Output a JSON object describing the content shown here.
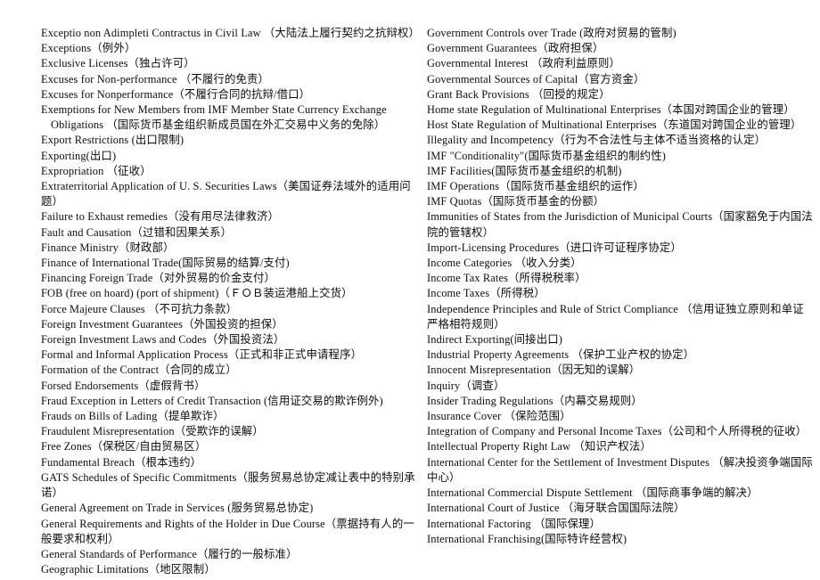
{
  "document": {
    "type": "glossary",
    "title": "",
    "language_pair": "English-Chinese",
    "layout": "two-column"
  },
  "columns": {
    "left": {
      "entries": [
        {
          "text": "Exceptio non Adimpleti Contractus in Civil Law （大陆法上履行契约之抗辩权）",
          "wrap_indent": true
        },
        {
          "text": "Exceptions（例外）",
          "wrap_indent": false
        },
        {
          "text": "Exclusive Licenses（独占许可）",
          "wrap_indent": false
        },
        {
          "text": "Excuses for Non-performance （不履行的免责）",
          "wrap_indent": false
        },
        {
          "text": "Excuses for Nonperformance（不履行合同的抗辩/借口）",
          "wrap_indent": false
        },
        {
          "text": "Exemptions for New Members from IMF Member State Currency Exchange Obligations （国际货币基金组织新成员国在外汇交易中义务的免除）",
          "wrap_indent": true
        },
        {
          "text": "Export Restrictions (出口限制)",
          "wrap_indent": false
        },
        {
          "text": "Exporting(出口)",
          "wrap_indent": false
        },
        {
          "text": "Expropriation （征收）",
          "wrap_indent": false
        },
        {
          "text": "Extraterritorial Application of U. S. Securities Laws（美国证券法域外的适用问题）",
          "wrap_indent": false
        },
        {
          "text": "Failure to Exhaust remedies（没有用尽法律救济）",
          "wrap_indent": false
        },
        {
          "text": "Fault and Causation（过错和因果关系）",
          "wrap_indent": false
        },
        {
          "text": "Finance Ministry（财政部）",
          "wrap_indent": false
        },
        {
          "text": "Finance of International Trade(国际贸易的结算/支付)",
          "wrap_indent": false
        },
        {
          "text": "Financing Foreign Trade（对外贸易的价金支付）",
          "wrap_indent": false
        },
        {
          "text": "FOB (free on hoard) (port of shipment)（ＦＯＢ装运港船上交货）",
          "wrap_indent": false
        },
        {
          "text": "Force Majeure Clauses （不可抗力条款）",
          "wrap_indent": false
        },
        {
          "text": "Foreign Investment Guarantees（外国投资的担保）",
          "wrap_indent": false
        },
        {
          "text": "Foreign Investment Laws and Codes（外国投资法）",
          "wrap_indent": false
        },
        {
          "text": "Formal and Informal Application Process（正式和非正式申请程序）",
          "wrap_indent": false
        },
        {
          "text": "Formation of the Contract（合同的成立）",
          "wrap_indent": false
        },
        {
          "text": "Forsed Endorsements（虚假背书）",
          "wrap_indent": false
        },
        {
          "text": "Fraud Exception in Letters of Credit Transaction (信用证交易的欺诈例外)",
          "wrap_indent": false
        },
        {
          "text": "Frauds on Bills of Lading（提单欺诈）",
          "wrap_indent": false
        },
        {
          "text": "Fraudulent Misrepresentation（受欺诈的误解）",
          "wrap_indent": false
        },
        {
          "text": "Free Zones（保税区/自由贸易区）",
          "wrap_indent": false
        },
        {
          "text": "Fundamental Breach（根本违约）",
          "wrap_indent": false
        },
        {
          "text": "GATS Schedules of Specific Commitments（服务贸易总协定减让表中的特别承诺）",
          "wrap_indent": false
        },
        {
          "text": "General Agreement on Trade in Services (服务贸易总协定)",
          "wrap_indent": false
        },
        {
          "text": "General Requirements and Rights of the Holder in Due Course（票据持有人的一般要求和权利）",
          "wrap_indent": false
        },
        {
          "text": "General Standards of Performance（履行的一般标准）",
          "wrap_indent": false
        },
        {
          "text": "Geographic Limitations（地区限制）",
          "wrap_indent": false
        }
      ]
    },
    "right": {
      "entries": [
        {
          "text": "Government Controls over Trade (政府对贸易的管制)",
          "wrap_indent": false
        },
        {
          "text": "Government Guarantees（政府担保）",
          "wrap_indent": false
        },
        {
          "text": "Governmental Interest （政府利益原则）",
          "wrap_indent": false
        },
        {
          "text": "Governmental Sources of Capital（官方资金）",
          "wrap_indent": false
        },
        {
          "text": "Grant Back Provisions （回授的规定）",
          "wrap_indent": false
        },
        {
          "text": "Home state Regulation of Multinational Enterprises（本国对跨国企业的管理）",
          "wrap_indent": false
        },
        {
          "text": "Host State Regulation of Multinational Enterprises（东道国对跨国企业的管理）",
          "wrap_indent": false
        },
        {
          "text": "Illegality and Incompetency（行为不合法性与主体不适当资格的认定）",
          "wrap_indent": false
        },
        {
          "text": "IMF \"Conditionality\"(国际货币基金组织的制约性)",
          "wrap_indent": false
        },
        {
          "text": "IMF Facilities(国际货币基金组织的机制)",
          "wrap_indent": false
        },
        {
          "text": "IMF Operations（国际货币基金组织的运作）",
          "wrap_indent": false
        },
        {
          "text": "IMF Quotas（国际货币基金的份额）",
          "wrap_indent": false
        },
        {
          "text": "Immunities of States from the Jurisdiction of Municipal Courts（国家豁免于内国法院的管辖权）",
          "wrap_indent": false
        },
        {
          "text": "Import-Licensing Procedures（进口许可证程序协定）",
          "wrap_indent": false
        },
        {
          "text": "Income Categories （收入分类）",
          "wrap_indent": false
        },
        {
          "text": "Income Tax Rates（所得税税率）",
          "wrap_indent": false
        },
        {
          "text": "Income Taxes（所得税）",
          "wrap_indent": false
        },
        {
          "text": "Independence Principles and Rule of Strict Compliance （信用证独立原则和单证严格相符规则）",
          "wrap_indent": false
        },
        {
          "text": "Indirect Exporting(间接出口)",
          "wrap_indent": false
        },
        {
          "text": "Industrial Property Agreements （保护工业产权的协定）",
          "wrap_indent": false
        },
        {
          "text": "Innocent Misrepresentation（因无知的误解）",
          "wrap_indent": false
        },
        {
          "text": "Inquiry（调查）",
          "wrap_indent": false
        },
        {
          "text": "Insider Trading Regulations（内幕交易规则）",
          "wrap_indent": false
        },
        {
          "text": "Insurance Cover （保险范围）",
          "wrap_indent": false
        },
        {
          "text": "Integration of Company and Personal Income Taxes（公司和个人所得税的征收）",
          "wrap_indent": false
        },
        {
          "text": "Intellectual Property Right Law （知识产权法）",
          "wrap_indent": false
        },
        {
          "text": "International Center for the Settlement of Investment Disputes （解决投资争端国际中心）",
          "wrap_indent": false
        },
        {
          "text": "International Commercial Dispute Settlement （国际商事争端的解决）",
          "wrap_indent": false
        },
        {
          "text": "International Court of Justice （海牙联合国国际法院）",
          "wrap_indent": false
        },
        {
          "text": "International Factoring （国际保理）",
          "wrap_indent": false
        },
        {
          "text": "International Franchising(国际特许经营权)",
          "wrap_indent": false
        }
      ]
    }
  }
}
